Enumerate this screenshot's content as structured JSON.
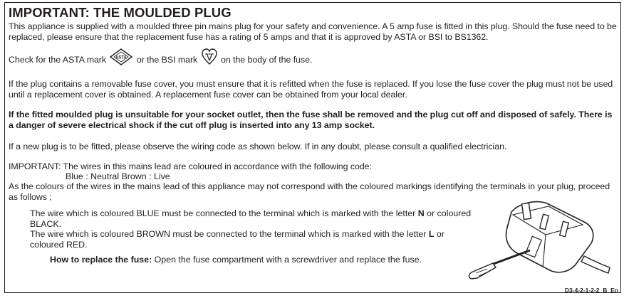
{
  "title": "IMPORTANT: THE MOULDED PLUG",
  "intro": "This appliance is supplied with a moulded three pin mains plug for your safety and convenience. A 5 amp fuse is fitted in this plug. Should the fuse need to be replaced, please ensure that the replacement fuse has a rating of 5 amps and that it is approved by ASTA or BSI to BS1362.",
  "check": {
    "part1": "Check for the ASTA mark",
    "part2": "or the BSI mark",
    "part3": "on the body of the fuse.",
    "asta_text": "ASTA"
  },
  "fuse_cover": "If the plug contains a removable fuse cover, you must ensure that it is refitted when the fuse is replaced. If you lose the fuse cover the plug must not be used until a replacement cover is obtained. A replacement fuse cover can be obtained from your local dealer.",
  "warning": "If the fitted moulded plug is unsuitable for your socket outlet, then the fuse shall be removed and the plug cut off and disposed of safely. There is a danger of severe electrical shock if the cut off plug is inserted into any 13 amp socket.",
  "new_plug": "If a new plug is to be fitted, please observe the wiring code as shown below. If in any doubt, please consult a qualified electrician.",
  "wires_intro": "IMPORTANT: The wires in this mains lead are coloured in accordance with the following code:",
  "wire_code": "Blue : Neutral   Brown : Live",
  "colours_note": "As the colours of the wires in the mains lead of this appliance may not correspond with the coloured markings identifying the terminals in your plug, proceed as follows ;",
  "blue": {
    "pre": "The wire which is coloured BLUE must be connected to the terminal which is marked with the letter ",
    "letter": "N",
    "post": " or coloured BLACK."
  },
  "brown": {
    "pre": "The wire which is coloured BROWN must be connected to the terminal which is marked with the letter ",
    "letter": "L",
    "post": " or coloured RED."
  },
  "replace": {
    "label": "How to replace the fuse:",
    "text": " Open the fuse compartment with a screwdriver and replace the fuse."
  },
  "doc_ref": "D3-4-2-1-2-2_B_En"
}
